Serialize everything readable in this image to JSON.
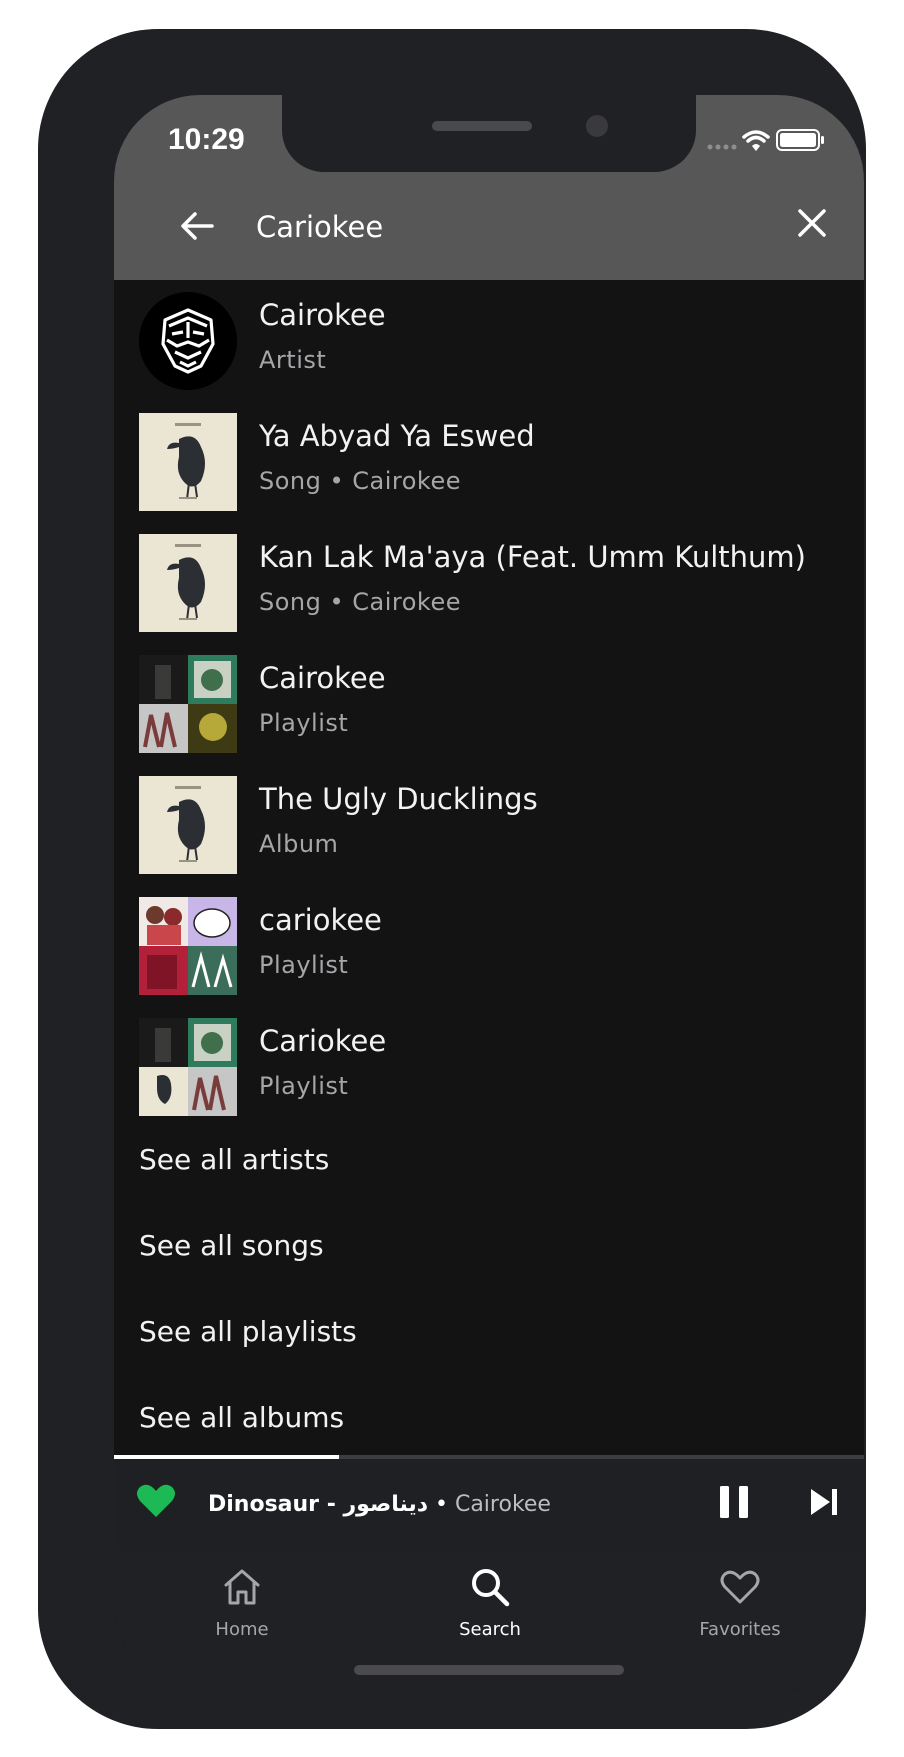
{
  "status_bar": {
    "time": "10:29"
  },
  "search": {
    "query": "Cariokee"
  },
  "results": [
    {
      "title": "Cairokee",
      "subtitle": "Artist",
      "art": "lion-logo"
    },
    {
      "title": "Ya Abyad Ya Eswed",
      "subtitle": "Song • Cairokee",
      "art": "album-cover"
    },
    {
      "title": "Kan Lak Ma'aya (Feat. Umm Kulthum)",
      "subtitle": "Song • Cairokee",
      "art": "album-cover"
    },
    {
      "title": "Cairokee",
      "subtitle": "Playlist",
      "art": "playlist-mosaic"
    },
    {
      "title": "The Ugly Ducklings",
      "subtitle": "Album",
      "art": "album-cover"
    },
    {
      "title": "cariokee",
      "subtitle": "Playlist",
      "art": "playlist-mosaic"
    },
    {
      "title": "Cariokee",
      "subtitle": "Playlist",
      "art": "playlist-mosaic"
    }
  ],
  "see_all": {
    "artists": "See all artists",
    "songs": "See all songs",
    "playlists": "See all playlists",
    "albums": "See all albums"
  },
  "now_playing": {
    "track": "Dinosaur - ديناصور",
    "separator": " • ",
    "artist": "Cairokee",
    "progress": 0.3,
    "favorited": true
  },
  "tabs": [
    {
      "label": "Home",
      "icon": "home-icon"
    },
    {
      "label": "Search",
      "icon": "search-icon",
      "active": true
    },
    {
      "label": "Favorites",
      "icon": "heart-icon"
    }
  ],
  "colors": {
    "accent": "#1db954",
    "background": "#131314",
    "header": "#575758",
    "active_tab": "#ffffff",
    "inactive_tab": "#a6a6a8"
  }
}
